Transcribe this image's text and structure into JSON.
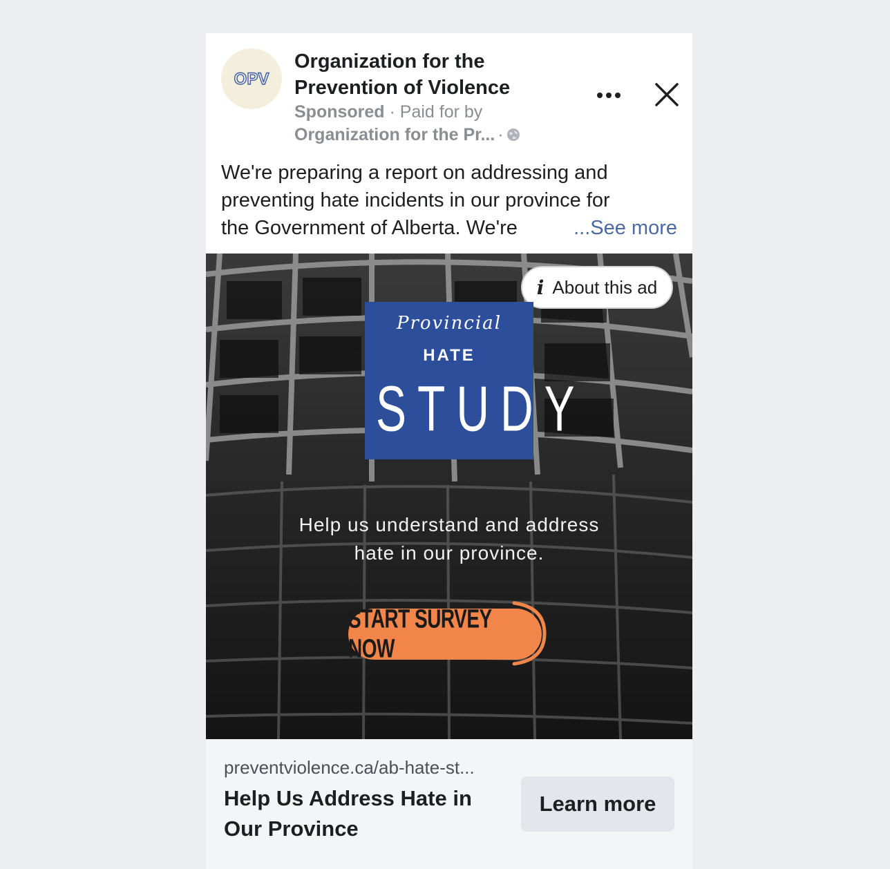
{
  "ad": {
    "page_name": "Organization for the Prevention of Violence",
    "logo_text": "OPV",
    "sponsored": "Sponsored",
    "paid_for_by": "· Paid for by",
    "payer": "Organization for the Pr...",
    "separator": "·",
    "body_lines": [
      "We're preparing a report on addressing and",
      "preventing hate incidents in our province for",
      "the Government of Alberta. We're"
    ],
    "see_more": "...See more",
    "about_ad": "About this ad",
    "creative": {
      "line1": "Provincial",
      "line2": "HATE",
      "line3": "STUDY",
      "tagline_1": "Help us understand and address",
      "tagline_2": "hate in our province.",
      "cta": "START SURVEY NOW"
    },
    "link_url": "preventviolence.ca/ab-hate-st...",
    "headline": "Help Us Address Hate in Our Province",
    "button": "Learn more"
  },
  "colors": {
    "brand_blue": "#2c4e9b",
    "cta_orange": "#f1854a",
    "link_blue": "#4b6aa3"
  }
}
